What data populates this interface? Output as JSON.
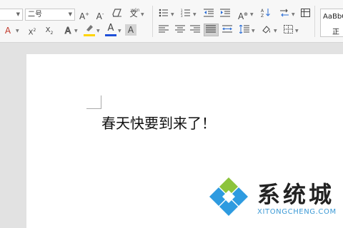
{
  "toolbar": {
    "font_name_value": "",
    "font_size_value": "二号",
    "style_sample": "AaBbC",
    "style_name": "正"
  },
  "colors": {
    "highlight": "#ffd400",
    "font_color": "#1e4fd8",
    "page": "#ffffff",
    "canvas": "#e2e2e2"
  },
  "document": {
    "text": "春天快要到来了！"
  },
  "watermark": {
    "title": "系统城",
    "url": "XITONGCHENG.COM",
    "logo": "diamond-logo-icon"
  }
}
